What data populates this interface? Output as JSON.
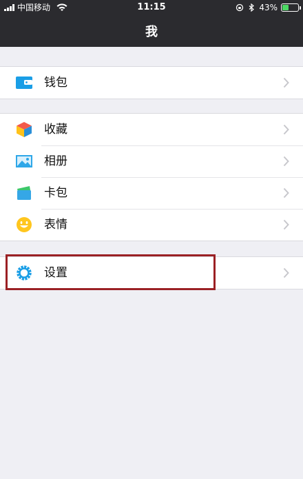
{
  "status_bar": {
    "carrier": "中国移动",
    "time": "11:15",
    "battery": "43%",
    "battery_level": 0.43
  },
  "header": {
    "title": "我"
  },
  "groups": [
    {
      "items": [
        {
          "label": "钱包",
          "icon": "wallet-icon"
        }
      ]
    },
    {
      "items": [
        {
          "label": "收藏",
          "icon": "favorites-cube-icon"
        },
        {
          "label": "相册",
          "icon": "album-picture-icon"
        },
        {
          "label": "卡包",
          "icon": "card-pack-icon"
        },
        {
          "label": "表情",
          "icon": "smiley-face-icon"
        }
      ]
    },
    {
      "items": [
        {
          "label": "设置",
          "icon": "settings-gear-icon"
        }
      ]
    }
  ],
  "colors": {
    "header_bg": "#2b2b2f",
    "page_bg": "#efeff4",
    "highlight_border": "#9b2024",
    "battery_fill": "#4cd964",
    "icon_blue": "#1a9ee6"
  }
}
